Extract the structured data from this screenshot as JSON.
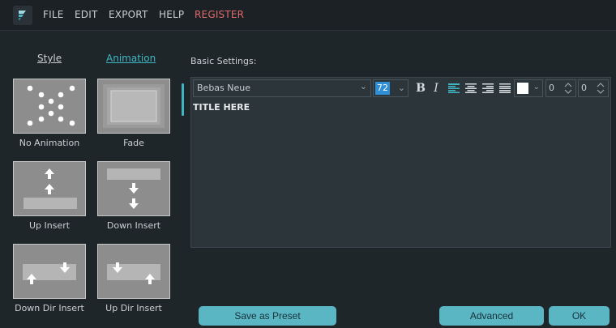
{
  "menu": {
    "logo_icon": "filmora-logo-icon",
    "items": [
      "FILE",
      "EDIT",
      "EXPORT",
      "HELP"
    ],
    "register": "REGISTER",
    "register_color": "#e06a6a"
  },
  "tabs": {
    "style": "Style",
    "animation": "Animation",
    "active_color": "#3fb6c4"
  },
  "animations": [
    "No Animation",
    "Fade",
    "Up Insert",
    "Down Insert",
    "Down Dir Insert",
    "Up Dir Insert"
  ],
  "settings": {
    "title": "Basic Settings:",
    "font": "Bebas Neue",
    "size": "72",
    "bold_icon": "B",
    "italic_icon": "I",
    "align_icons": [
      "align-left-icon",
      "align-center-icon",
      "align-right-icon",
      "justify-icon"
    ],
    "text_color": "#ffffff",
    "spin1": "0",
    "spin2": "0",
    "text": "TITLE HERE"
  },
  "buttons": {
    "preset": "Save as Preset",
    "advanced": "Advanced",
    "ok": "OK",
    "color": "#5bb6c3"
  }
}
